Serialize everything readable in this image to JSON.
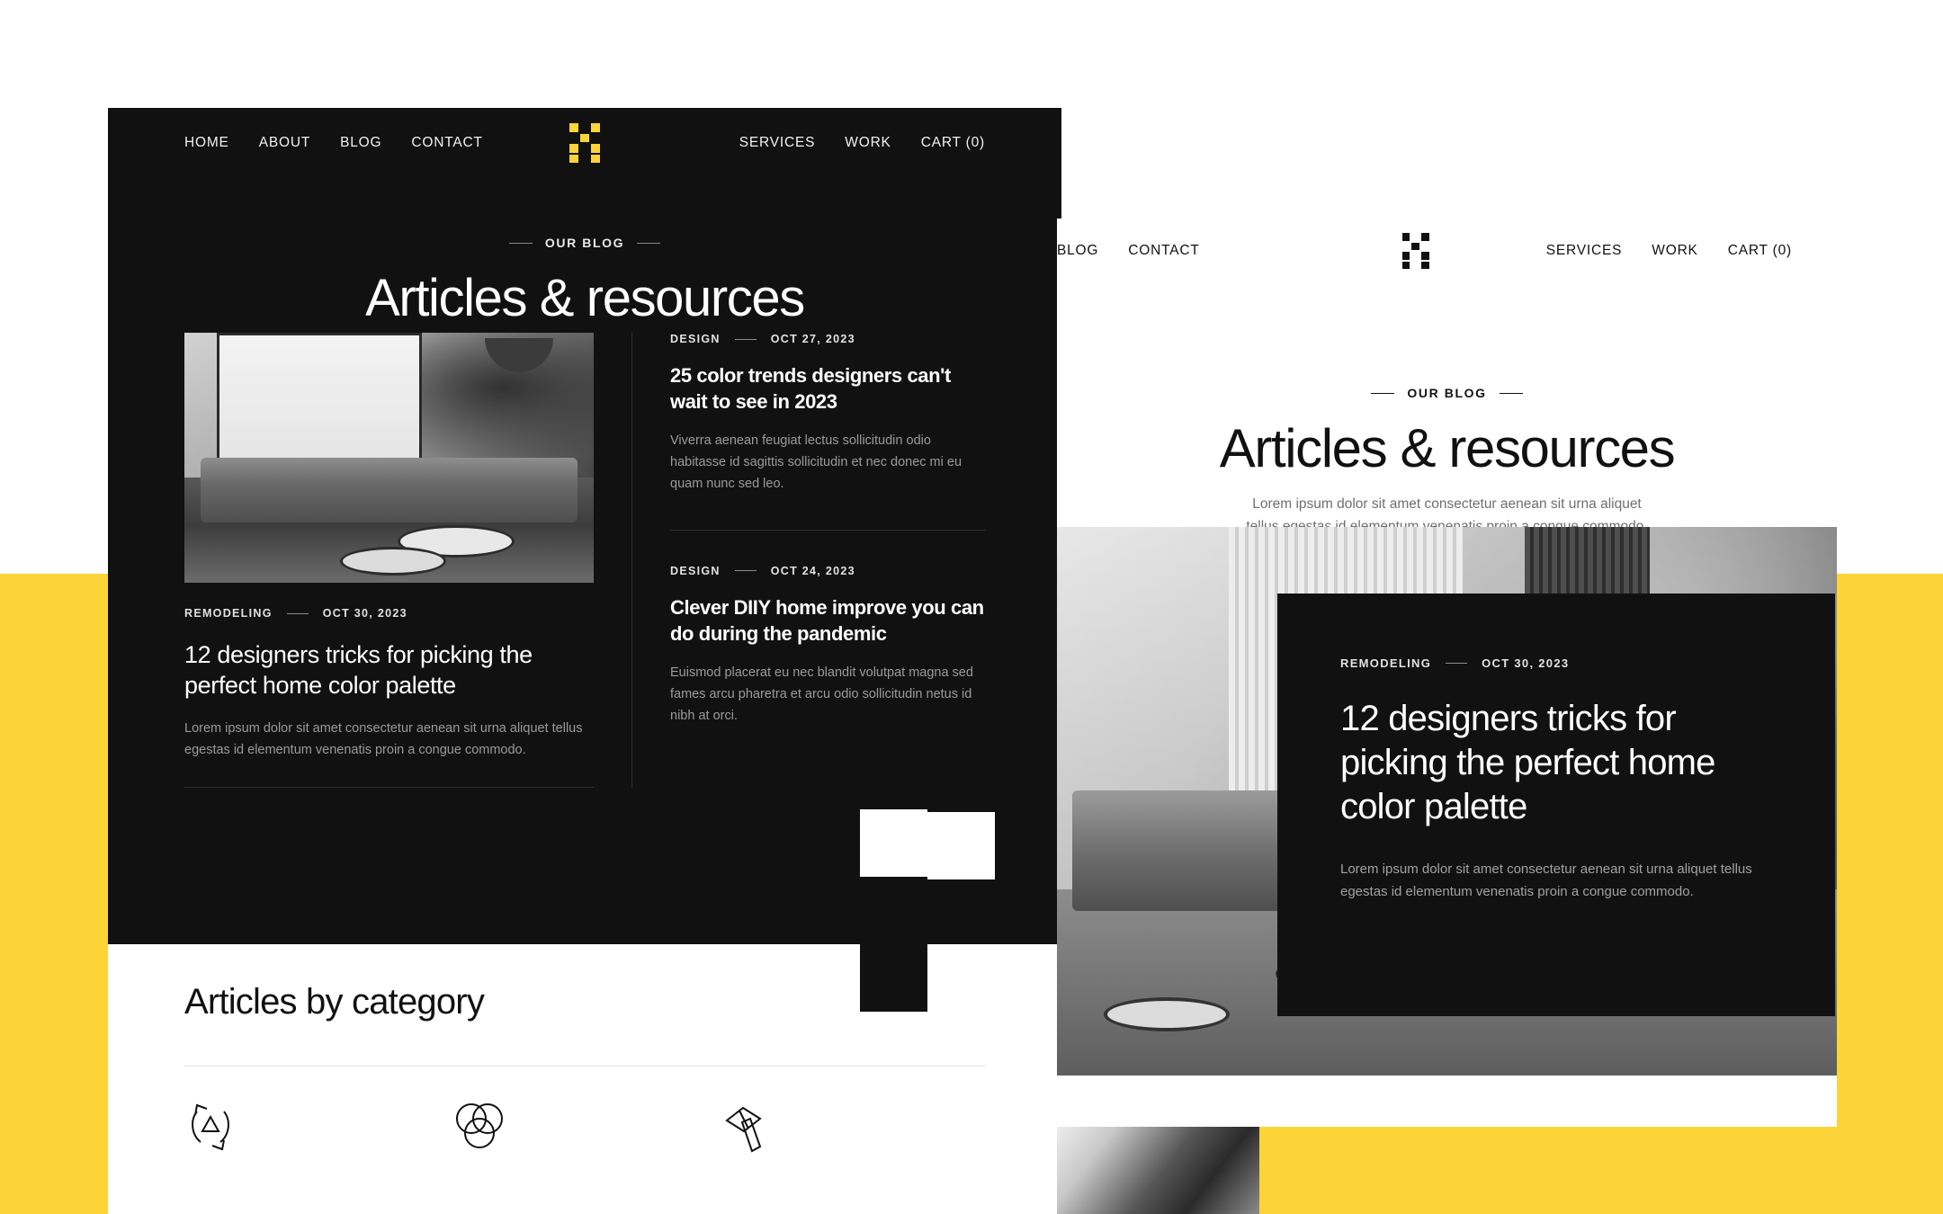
{
  "colors": {
    "yellow": "#FCD438",
    "dark": "#111111",
    "white": "#FFFFFF",
    "muted": "#9B9B9B"
  },
  "left_mockup": {
    "nav": {
      "left_items": [
        {
          "label": "HOME",
          "name": "nav-home"
        },
        {
          "label": "ABOUT",
          "name": "nav-about"
        },
        {
          "label": "BLOG",
          "name": "nav-blog"
        },
        {
          "label": "CONTACT",
          "name": "nav-contact"
        }
      ],
      "right_items": [
        {
          "label": "SERVICES",
          "name": "nav-services"
        },
        {
          "label": "WORK",
          "name": "nav-work"
        },
        {
          "label": "CART (0)",
          "name": "nav-cart"
        }
      ],
      "logo_name": "brand-logo-icon"
    },
    "eyebrow": "OUR BLOG",
    "title": "Articles & resources",
    "featured": {
      "category": "REMODELING",
      "date": "OCT 30, 2023",
      "title": "12 designers tricks for picking the perfect home color palette",
      "excerpt": "Lorem ipsum dolor sit amet consectetur aenean sit urna aliquet tellus egestas id elementum venenatis proin a congue commodo.",
      "image_name": "living-room-photo"
    },
    "list": [
      {
        "category": "DESIGN",
        "date": "OCT 27, 2023",
        "title": "25 color trends designers can't wait to see in 2023",
        "excerpt": "Viverra aenean feugiat lectus sollicitudin odio habitasse id sagittis sollicitudin et nec donec mi eu quam nunc sed leo."
      },
      {
        "category": "DESIGN",
        "date": "OCT 24, 2023",
        "title": "Clever DIIY home improve you can do during the pandemic",
        "excerpt": "Euismod placerat eu nec blandit volutpat magna sed fames arcu pharetra et arcu odio sollicitudin netus id nibh at orci."
      }
    ],
    "categories_section": {
      "title": "Articles by category",
      "icons": [
        {
          "name": "recycle-triangle-icon"
        },
        {
          "name": "three-circles-icon"
        },
        {
          "name": "hammer-icon"
        }
      ]
    }
  },
  "right_mockup": {
    "nav": {
      "left_items": [
        {
          "label": "BLOG",
          "name": "nav-blog"
        },
        {
          "label": "CONTACT",
          "name": "nav-contact"
        }
      ],
      "right_items": [
        {
          "label": "SERVICES",
          "name": "nav-services"
        },
        {
          "label": "WORK",
          "name": "nav-work"
        },
        {
          "label": "CART (0)",
          "name": "nav-cart"
        }
      ],
      "logo_name": "brand-logo-icon"
    },
    "eyebrow": "OUR BLOG",
    "title": "Articles & resources",
    "subtitle": "Lorem ipsum dolor sit amet consectetur aenean sit urna aliquet tellus egestas id elementum venenatis proin a congue commodo.",
    "card": {
      "category": "REMODELING",
      "date": "OCT 30, 2023",
      "title": "12 designers tricks for picking the perfect home color palette",
      "excerpt": "Lorem ipsum dolor sit amet consectetur aenean sit urna aliquet tellus egestas id elementum venenatis proin a congue commodo.",
      "image_name": "living-room-photo"
    }
  }
}
